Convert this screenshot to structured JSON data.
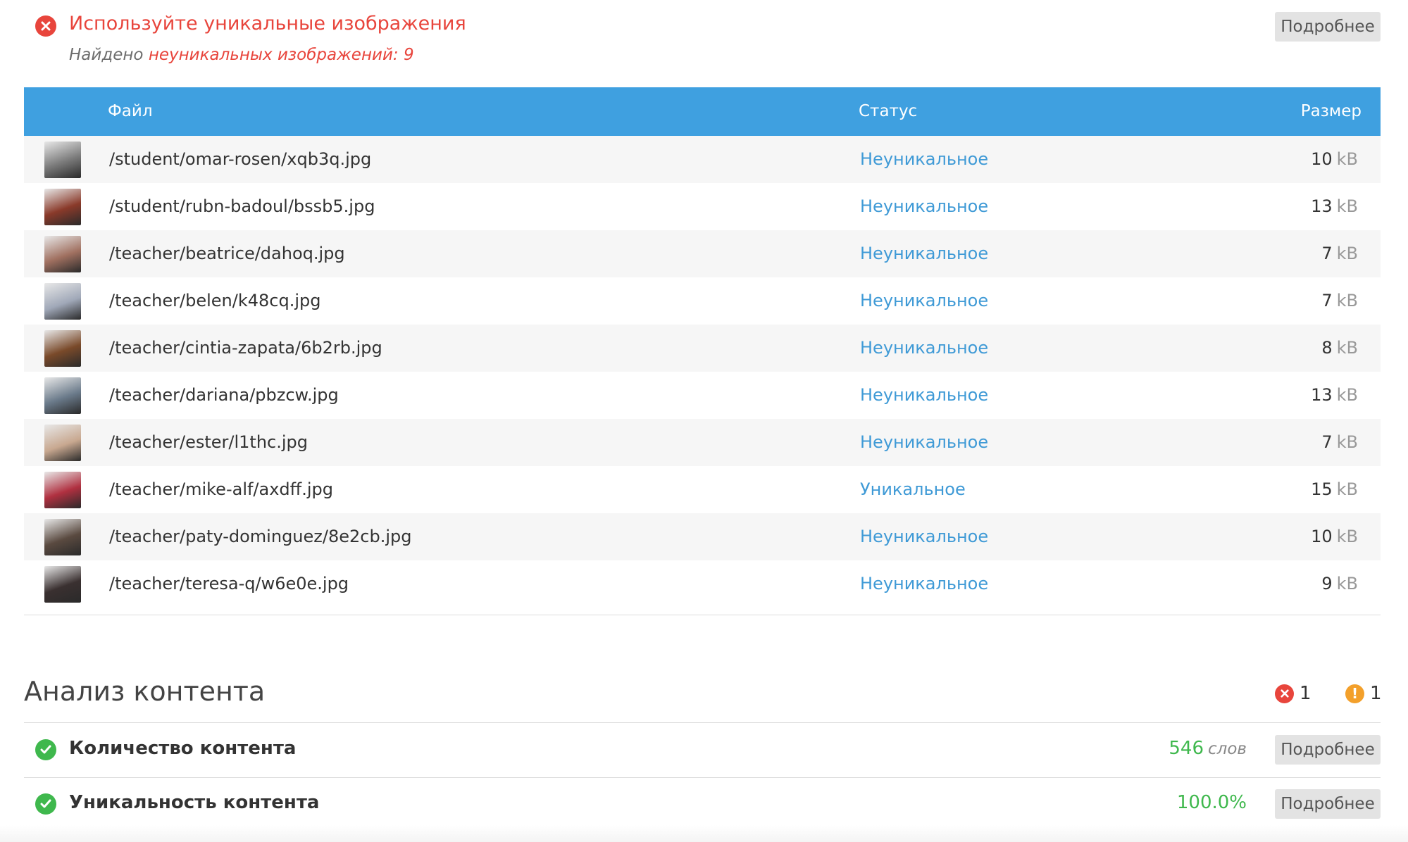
{
  "issue": {
    "title": "Используйте уникальные изображения",
    "found_prefix": "Найдено",
    "found_highlight": "неуникальных изображений: 9",
    "more_label": "Подробнее",
    "icon": "close-circle-icon",
    "color": "#e8453c"
  },
  "table": {
    "header_color": "#3fa0e0",
    "columns": {
      "file": "Файл",
      "status": "Статус",
      "size": "Размер"
    },
    "unit": "kB",
    "rows": [
      {
        "file": "/student/omar-rosen/xqb3q.jpg",
        "status": "Неуникальное",
        "size": "10",
        "thumb_color": "#7a7a7a"
      },
      {
        "file": "/student/rubn-badoul/bssb5.jpg",
        "status": "Неуникальное",
        "size": "13",
        "thumb_color": "#8a3a2a"
      },
      {
        "file": "/teacher/beatrice/dahoq.jpg",
        "status": "Неуникальное",
        "size": "7",
        "thumb_color": "#a07060"
      },
      {
        "file": "/teacher/belen/k48cq.jpg",
        "status": "Неуникальное",
        "size": "7",
        "thumb_color": "#a0a8b8"
      },
      {
        "file": "/teacher/cintia-zapata/6b2rb.jpg",
        "status": "Неуникальное",
        "size": "8",
        "thumb_color": "#7a4a2a"
      },
      {
        "file": "/teacher/dariana/pbzcw.jpg",
        "status": "Неуникальное",
        "size": "13",
        "thumb_color": "#6a7a8a"
      },
      {
        "file": "/teacher/ester/l1thc.jpg",
        "status": "Неуникальное",
        "size": "7",
        "thumb_color": "#c8a890"
      },
      {
        "file": "/teacher/mike-alf/axdff.jpg",
        "status": "Уникальное",
        "size": "15",
        "thumb_color": "#b03040"
      },
      {
        "file": "/teacher/paty-dominguez/8e2cb.jpg",
        "status": "Неуникальное",
        "size": "10",
        "thumb_color": "#5a4a40"
      },
      {
        "file": "/teacher/teresa-q/w6e0e.jpg",
        "status": "Неуникальное",
        "size": "9",
        "thumb_color": "#3a3030"
      }
    ]
  },
  "content_analysis": {
    "title": "Анализ контента",
    "error_count": "1",
    "warning_count": "1",
    "rows": [
      {
        "label": "Количество контента",
        "value": "546",
        "unit": "слов",
        "more_label": "Подробнее"
      },
      {
        "label": "Уникальность контента",
        "value": "100.0%",
        "unit": "",
        "more_label": "Подробнее"
      }
    ]
  }
}
